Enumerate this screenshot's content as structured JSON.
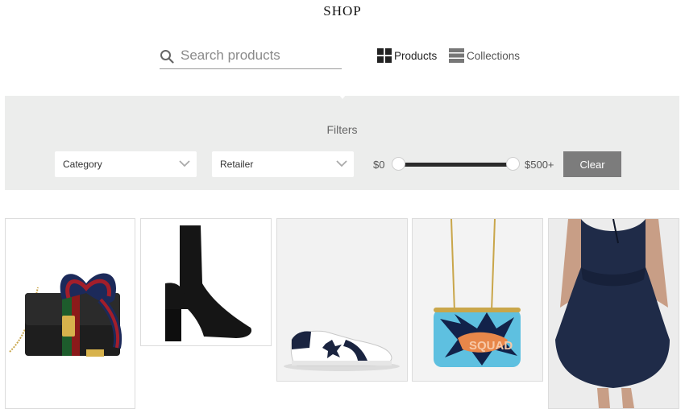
{
  "header": {
    "title": "SHOP"
  },
  "search": {
    "placeholder": "Search products",
    "value": ""
  },
  "view_toggle": {
    "products_label": "Products",
    "collections_label": "Collections",
    "active": "Products"
  },
  "filters": {
    "heading": "Filters",
    "category_label": "Category",
    "retailer_label": "Retailer",
    "price_min_label": "$0",
    "price_max_label": "$500+",
    "clear_label": "Clear"
  },
  "products": [
    {
      "name": "handbag",
      "icon": "handbag-icon"
    },
    {
      "name": "ankle-boot",
      "icon": "boot-icon"
    },
    {
      "name": "sneaker",
      "icon": "sneaker-icon"
    },
    {
      "name": "clutch",
      "icon": "clutch-icon"
    },
    {
      "name": "dress",
      "icon": "dress-icon"
    }
  ]
}
